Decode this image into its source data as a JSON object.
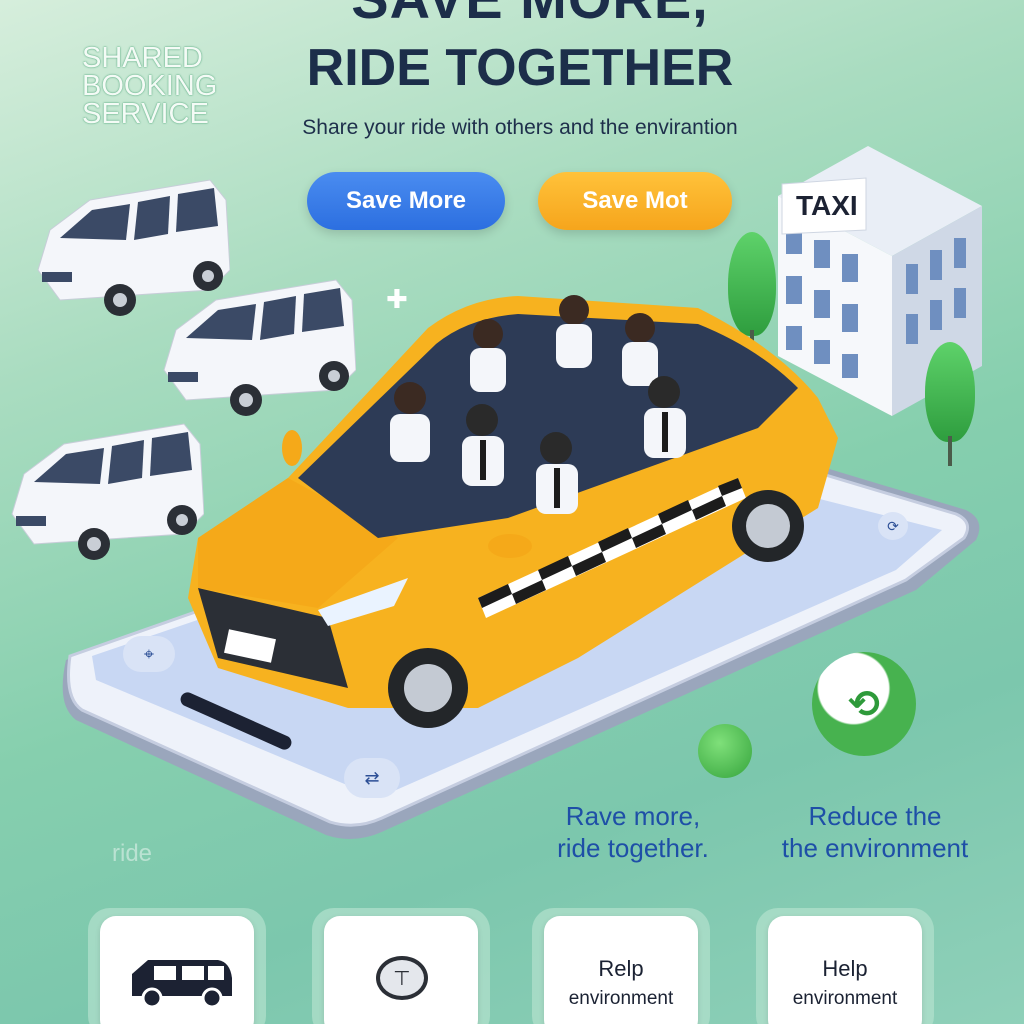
{
  "headline": {
    "top_line": "SAVE MORE,",
    "main": "RIDE TOGETHER",
    "subtitle": "Share your ride with others and the envirantion"
  },
  "brand": {
    "line1": "SHARED",
    "line2": "BOOKING",
    "line3": "SERVICE"
  },
  "buttons": {
    "primary_label": "Save More",
    "secondary_label": "Save Mot"
  },
  "building": {
    "sign": "TAXI"
  },
  "captions": {
    "left_line1": "Rave more,",
    "left_line2": "ride together.",
    "right_line1": "Reduce the",
    "right_line2": "the environment",
    "ghost": "ride"
  },
  "cards": [
    {
      "icon": "van-icon",
      "label": ""
    },
    {
      "icon": "steering-badge-icon",
      "label": ""
    },
    {
      "icon": "",
      "label_line1": "Relp",
      "label_line2": "environment"
    },
    {
      "icon": "",
      "label_line1": "Help",
      "label_line2": "environment"
    }
  ],
  "colors": {
    "accent_blue": "#2c6fe0",
    "accent_yellow": "#f6a51c",
    "taxi_yellow": "#f7b21f",
    "headline": "#1c2e4a",
    "caption_blue": "#1e4fa7"
  }
}
